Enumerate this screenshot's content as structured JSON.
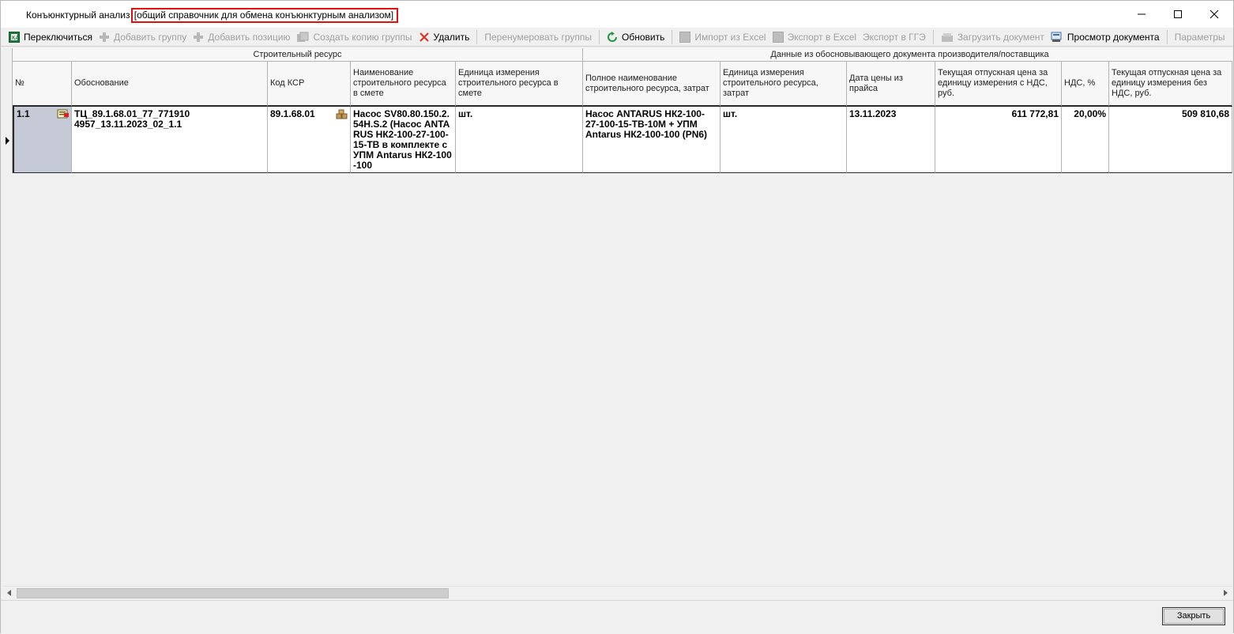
{
  "window": {
    "title": "Конъюнктурный анализ",
    "title_suffix": "[общий справочник для обмена конъюнктурным анализом]"
  },
  "toolbar": {
    "switch_label": "Переключиться",
    "add_group_label": "Добавить группу",
    "add_position_label": "Добавить позицию",
    "copy_group_label": "Создать копию группы",
    "delete_label": "Удалить",
    "renumber_label": "Перенумеровать группы",
    "refresh_label": "Обновить",
    "import_excel_label": "Импорт из Excel",
    "export_excel_label": "Экспорт в Excel",
    "export_gge_label": "Экспорт в ГГЭ",
    "upload_doc_label": "Загрузить документ",
    "view_doc_label": "Просмотр документа",
    "params_label": "Параметры"
  },
  "grid": {
    "group_headers": {
      "resource": "Строительный ресурс",
      "supplier": "Данные из обосновывающего документа производителя/поставщика"
    },
    "columns": {
      "num": "№",
      "basis": "Обоснование",
      "ksr": "Код КСР",
      "name": "Наименование строительного ресурса в смете",
      "unit": "Единица измерения строительного ресурса в смете",
      "full_name": "Полное наименование строительного ресурса, затрат",
      "unit2": "Единица измерения строительного ресурса, затрат",
      "price_date": "Дата цены из прайса",
      "price_vat": "Текущая отпускная цена за единицу измерения с НДС, руб.",
      "vat": "НДС, %",
      "price_novat": "Текущая отпускная цена за единицу измерения без НДС, руб."
    },
    "rows": [
      {
        "num": "1.1",
        "basis": "ТЦ_89.1.68.01_77_771910 4957_13.11.2023_02_1.1",
        "ksr": "89.1.68.01",
        "name": "Насос SV80.80.150.2.54H.S.2 (Насос ANTARUS НК2-100-27-100-15-ТВ в комплекте с УПМ Antarus НК2-100-100",
        "unit": "шт.",
        "full_name": "Насос ANTARUS НК2-100-27-100-15-ТВ-10М + УПМ Antarus НК2-100-100 (PN6)",
        "unit2": "шт.",
        "price_date": "13.11.2023",
        "price_vat": "611 772,81",
        "vat": "20,00%",
        "price_novat": "509 810,68"
      }
    ]
  },
  "footer": {
    "close_label": "Закрыть"
  }
}
